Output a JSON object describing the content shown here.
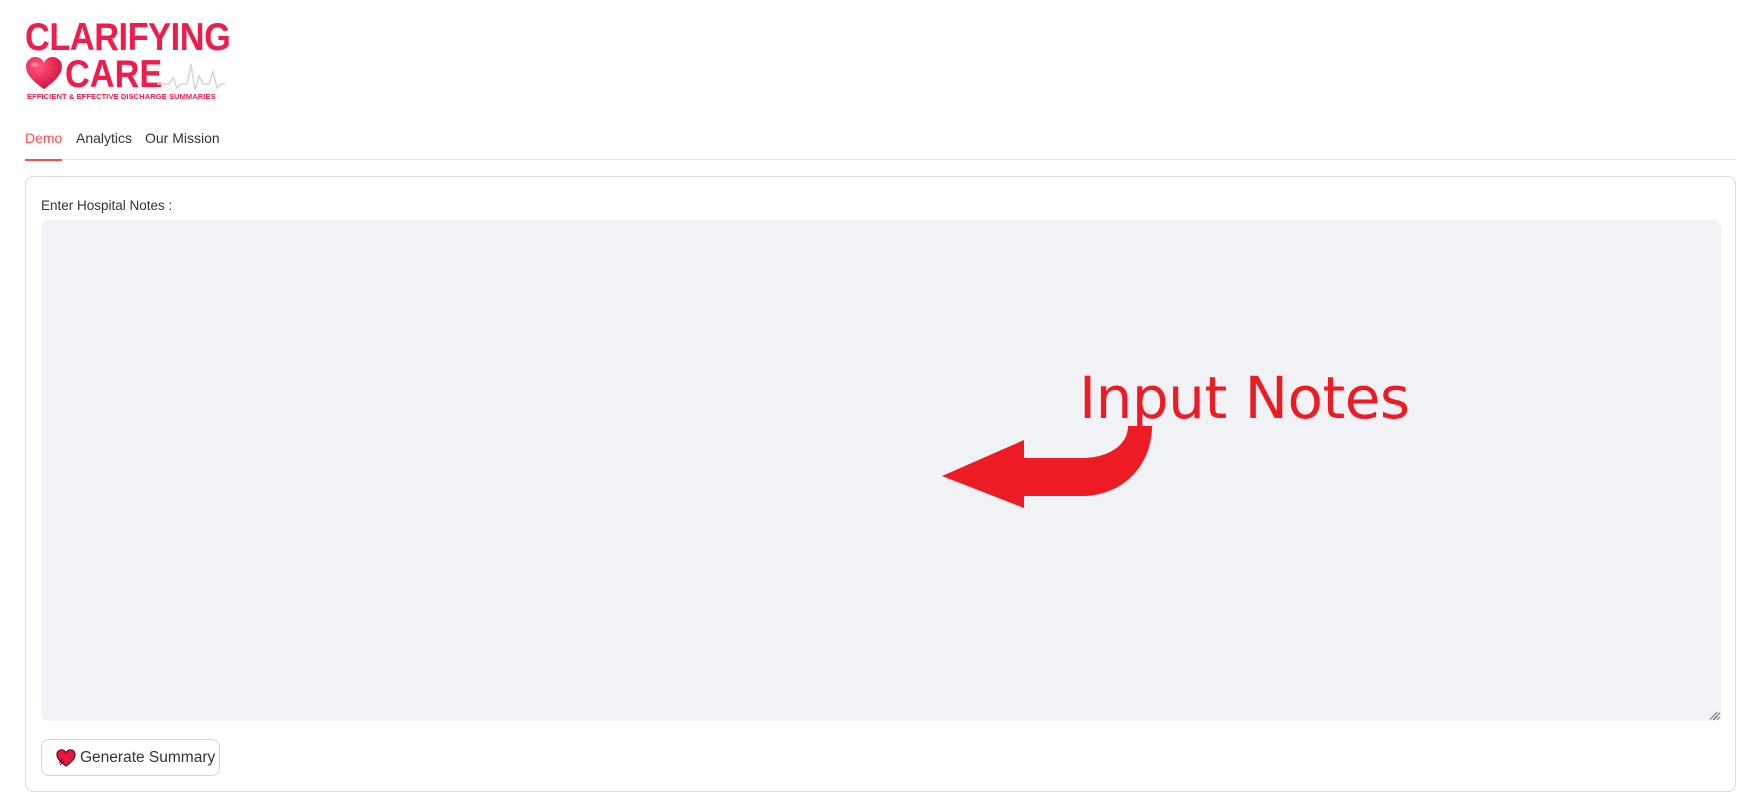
{
  "brand": {
    "line1": "CLARIFYING",
    "line2": "CARE",
    "tagline": "EFFICIENT & EFFECTIVE DISCHARGE SUMMARIES",
    "color": "#f01d4c",
    "icons": [
      "heart-icon",
      "ekg-line-icon"
    ]
  },
  "tabs": [
    {
      "label": "Demo",
      "active": true
    },
    {
      "label": "Analytics",
      "active": false
    },
    {
      "label": "Our Mission",
      "active": false
    }
  ],
  "form": {
    "notes_label": "Enter Hospital Notes :",
    "notes_value": "",
    "button_label": "Generate Summary",
    "button_icon": "heart-icon"
  },
  "annotation": {
    "text": "Input Notes",
    "color": "#ed1c24",
    "icon": "curved-arrow-left-icon"
  },
  "accent_color": "#ff4b4b"
}
